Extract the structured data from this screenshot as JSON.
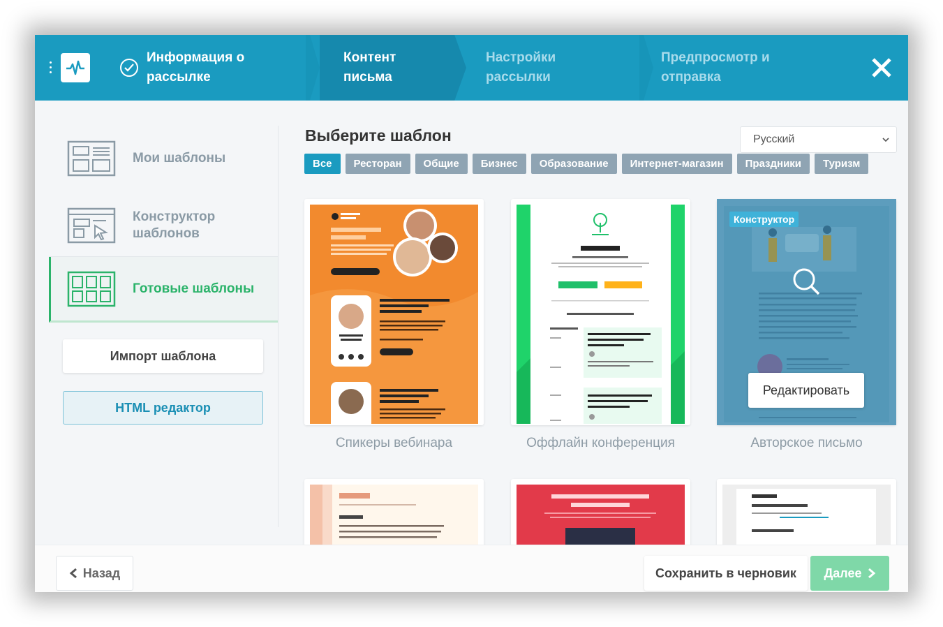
{
  "header": {
    "steps": [
      {
        "label": "Информация о рассылке",
        "done": true
      },
      {
        "label": "Контент письма",
        "active": true
      },
      {
        "label": "Настройки рассылки"
      },
      {
        "label": "Предпросмотр и отправка"
      }
    ],
    "close_icon": "close-icon",
    "colors": {
      "header": "#1a9bc0",
      "active_step": "#1689ad",
      "inactive_text": "#a8dbeb"
    }
  },
  "sidebar": {
    "items": [
      {
        "label": "Мои шаблоны",
        "icon": "my-templates-icon"
      },
      {
        "label": "Конструктор шаблонов",
        "icon": "template-builder-icon"
      },
      {
        "label": "Готовые шаблоны",
        "icon": "ready-templates-icon",
        "active": true
      }
    ],
    "import_label": "Импорт шаблона",
    "html_editor_label": "HTML редактор"
  },
  "main": {
    "title": "Выберите шаблон",
    "language": "Русский",
    "filters": [
      "Все",
      "Ресторан",
      "Общие",
      "Бизнес",
      "Образование",
      "Интернет-магазин",
      "Праздники",
      "Туризм"
    ],
    "active_filter": "Все",
    "cards": [
      {
        "title": "Спикеры вебинара"
      },
      {
        "title": "Оффлайн конференция"
      },
      {
        "title": "Авторское письмо",
        "badge": "Конструктор",
        "edit_label": "Редактировать"
      }
    ]
  },
  "footer": {
    "back_label": "Назад",
    "draft_label": "Сохранить в черновик",
    "next_label": "Далее",
    "next_color": "#7fd8a8"
  }
}
